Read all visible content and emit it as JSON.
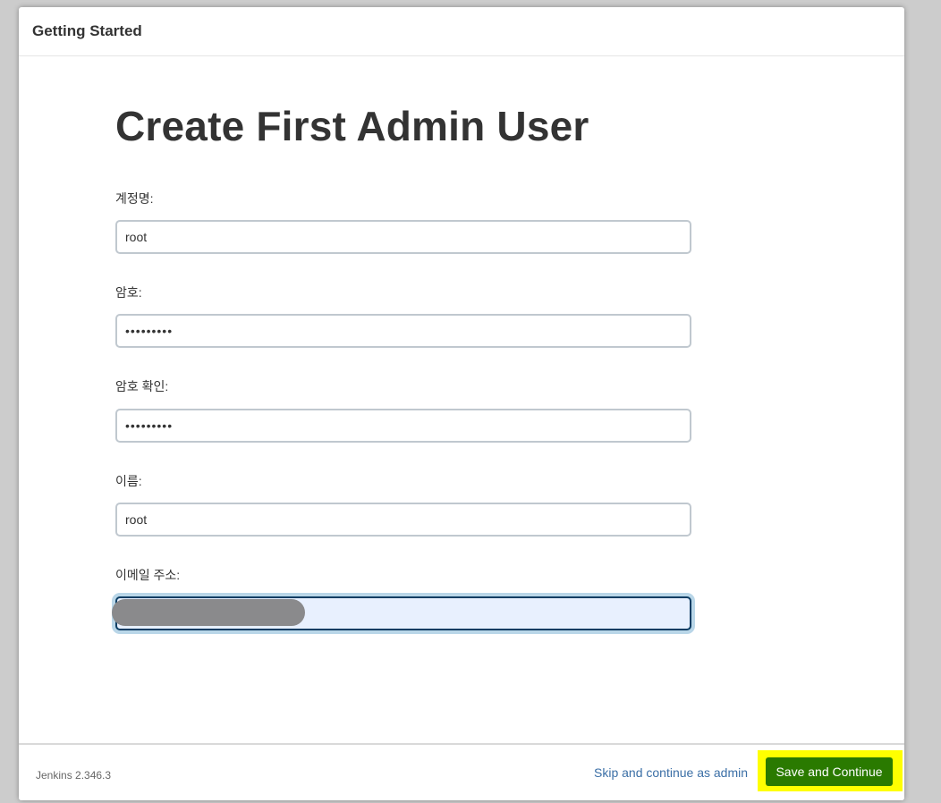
{
  "header": {
    "title": "Getting Started"
  },
  "main": {
    "title": "Create First Admin User",
    "fields": [
      {
        "label": "계정명:",
        "value": "root",
        "type": "text"
      },
      {
        "label": "암호:",
        "value": "•••••••••",
        "type": "password"
      },
      {
        "label": "암호 확인:",
        "value": "•••••••••",
        "type": "password"
      },
      {
        "label": "이름:",
        "value": "root",
        "type": "text"
      },
      {
        "label": "이메일 주소:",
        "value": "",
        "type": "email",
        "focused": true
      }
    ]
  },
  "footer": {
    "version": "Jenkins 2.346.3",
    "skip_label": "Skip and continue as admin",
    "save_label": "Save and Continue"
  },
  "colors": {
    "save_button": "#2a7a00",
    "highlight": "#ffff00",
    "link": "#3b6fa6"
  }
}
